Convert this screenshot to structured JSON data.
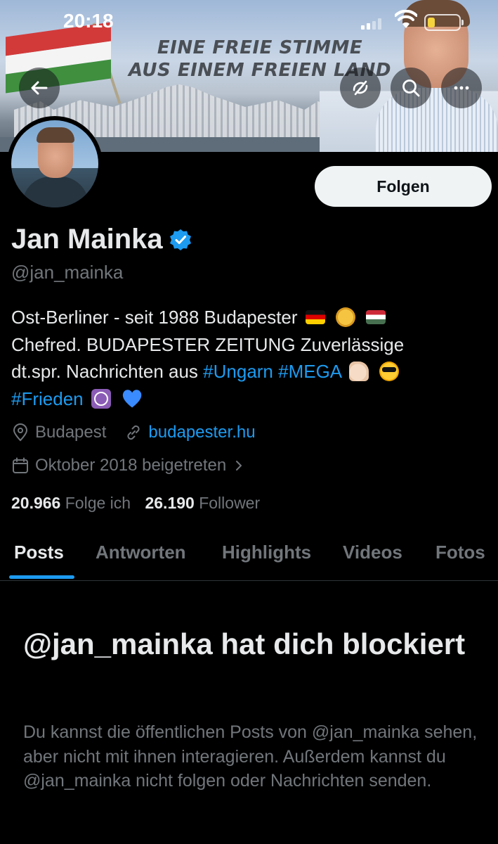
{
  "status_bar": {
    "time": "20:18"
  },
  "banner": {
    "slogan_line1": "EINE FREIE STIMME",
    "slogan_line2": "AUS EINEM FREIEN LAND"
  },
  "header_icons": [
    "back-arrow-icon",
    "no-translate-icon",
    "search-icon",
    "more-icon"
  ],
  "profile": {
    "name": "Jan Mainka",
    "handle": "@jan_mainka",
    "follow_label": "Folgen",
    "bio": {
      "line1": "Ost-Berliner - seit 1988 Budapester",
      "line2": "Chefred. BUDAPESTER ZEITUNG Zuverlässige",
      "line3_text": "dt.spr. Nachrichten aus",
      "tag_ungarn": "#Ungarn",
      "tag_mega": "#MEGA",
      "tag_frieden": "#Frieden"
    },
    "location": "Budapest",
    "website": "budapester.hu",
    "joined": "Oktober 2018 beigetreten",
    "following_count": "20.966",
    "following_label": "Folge ich",
    "followers_count": "26.190",
    "followers_label": "Follower"
  },
  "tabs": [
    "Posts",
    "Antworten",
    "Highlights",
    "Videos",
    "Fotos"
  ],
  "active_tab": "Posts",
  "blocked": {
    "title": "@jan_mainka hat dich blockiert",
    "text": "Du kannst die öffentlichen Posts von @jan_mainka sehen, aber nicht mit ihnen interagieren. Außerdem kannst du @jan_mainka nicht folgen oder Nachrichten senden."
  },
  "colors": {
    "accent": "#1d9bf0",
    "background": "#000000",
    "text": "#e7e9ea",
    "muted": "#71767b"
  }
}
